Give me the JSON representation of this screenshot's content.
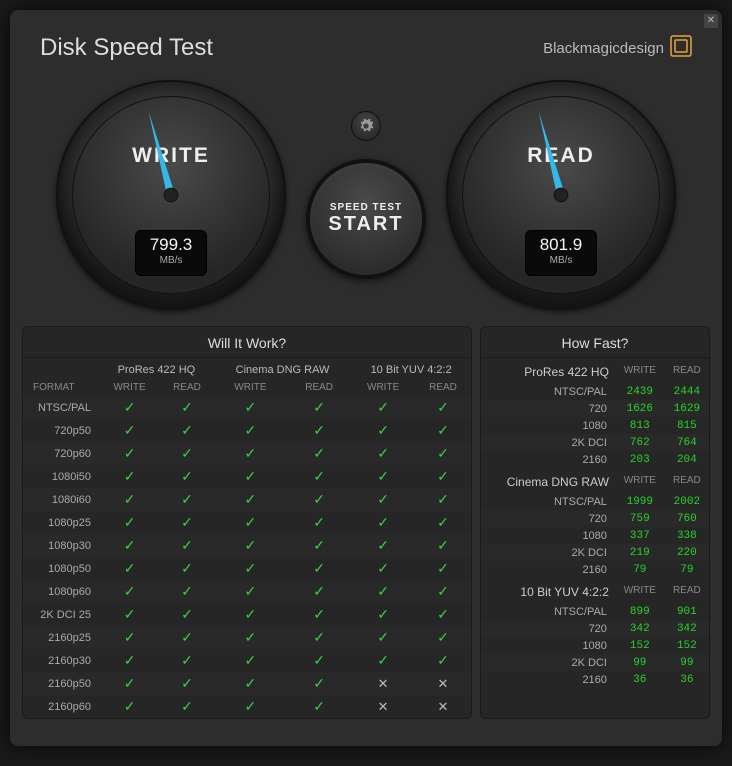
{
  "title": "Disk Speed Test",
  "brand": "Blackmagicdesign",
  "write_label": "WRITE",
  "read_label": "READ",
  "write_value": "799.3",
  "read_value": "801.9",
  "unit": "MB/s",
  "start_small": "SPEED TEST",
  "start_big": "START",
  "will_title": "Will It Work?",
  "fast_title": "How Fast?",
  "col_write": "WRITE",
  "col_read": "READ",
  "format_label": "FORMAT",
  "codecs": [
    "ProRes 422 HQ",
    "Cinema DNG RAW",
    "10 Bit YUV 4:2:2"
  ],
  "will_formats": [
    "NTSC/PAL",
    "720p50",
    "720p60",
    "1080i50",
    "1080i60",
    "1080p25",
    "1080p30",
    "1080p50",
    "1080p60",
    "2K DCI 25",
    "2160p25",
    "2160p30",
    "2160p50",
    "2160p60"
  ],
  "will_results": [
    [
      [
        true,
        true
      ],
      [
        true,
        true
      ],
      [
        true,
        true
      ]
    ],
    [
      [
        true,
        true
      ],
      [
        true,
        true
      ],
      [
        true,
        true
      ]
    ],
    [
      [
        true,
        true
      ],
      [
        true,
        true
      ],
      [
        true,
        true
      ]
    ],
    [
      [
        true,
        true
      ],
      [
        true,
        true
      ],
      [
        true,
        true
      ]
    ],
    [
      [
        true,
        true
      ],
      [
        true,
        true
      ],
      [
        true,
        true
      ]
    ],
    [
      [
        true,
        true
      ],
      [
        true,
        true
      ],
      [
        true,
        true
      ]
    ],
    [
      [
        true,
        true
      ],
      [
        true,
        true
      ],
      [
        true,
        true
      ]
    ],
    [
      [
        true,
        true
      ],
      [
        true,
        true
      ],
      [
        true,
        true
      ]
    ],
    [
      [
        true,
        true
      ],
      [
        true,
        true
      ],
      [
        true,
        true
      ]
    ],
    [
      [
        true,
        true
      ],
      [
        true,
        true
      ],
      [
        true,
        true
      ]
    ],
    [
      [
        true,
        true
      ],
      [
        true,
        true
      ],
      [
        true,
        true
      ]
    ],
    [
      [
        true,
        true
      ],
      [
        true,
        true
      ],
      [
        true,
        true
      ]
    ],
    [
      [
        true,
        true
      ],
      [
        true,
        true
      ],
      [
        false,
        false
      ]
    ],
    [
      [
        true,
        true
      ],
      [
        true,
        true
      ],
      [
        false,
        false
      ]
    ]
  ],
  "fast_sections": [
    {
      "name": "ProRes 422 HQ",
      "rows": [
        {
          "res": "NTSC/PAL",
          "w": "2439",
          "r": "2444"
        },
        {
          "res": "720",
          "w": "1626",
          "r": "1629"
        },
        {
          "res": "1080",
          "w": "813",
          "r": "815"
        },
        {
          "res": "2K DCI",
          "w": "762",
          "r": "764"
        },
        {
          "res": "2160",
          "w": "203",
          "r": "204"
        }
      ]
    },
    {
      "name": "Cinema DNG RAW",
      "rows": [
        {
          "res": "NTSC/PAL",
          "w": "1999",
          "r": "2002"
        },
        {
          "res": "720",
          "w": "759",
          "r": "760"
        },
        {
          "res": "1080",
          "w": "337",
          "r": "338"
        },
        {
          "res": "2K DCI",
          "w": "219",
          "r": "220"
        },
        {
          "res": "2160",
          "w": "79",
          "r": "79"
        }
      ]
    },
    {
      "name": "10 Bit YUV 4:2:2",
      "rows": [
        {
          "res": "NTSC/PAL",
          "w": "899",
          "r": "901"
        },
        {
          "res": "720",
          "w": "342",
          "r": "342"
        },
        {
          "res": "1080",
          "w": "152",
          "r": "152"
        },
        {
          "res": "2K DCI",
          "w": "99",
          "r": "99"
        },
        {
          "res": "2160",
          "w": "36",
          "r": "36"
        }
      ]
    }
  ]
}
